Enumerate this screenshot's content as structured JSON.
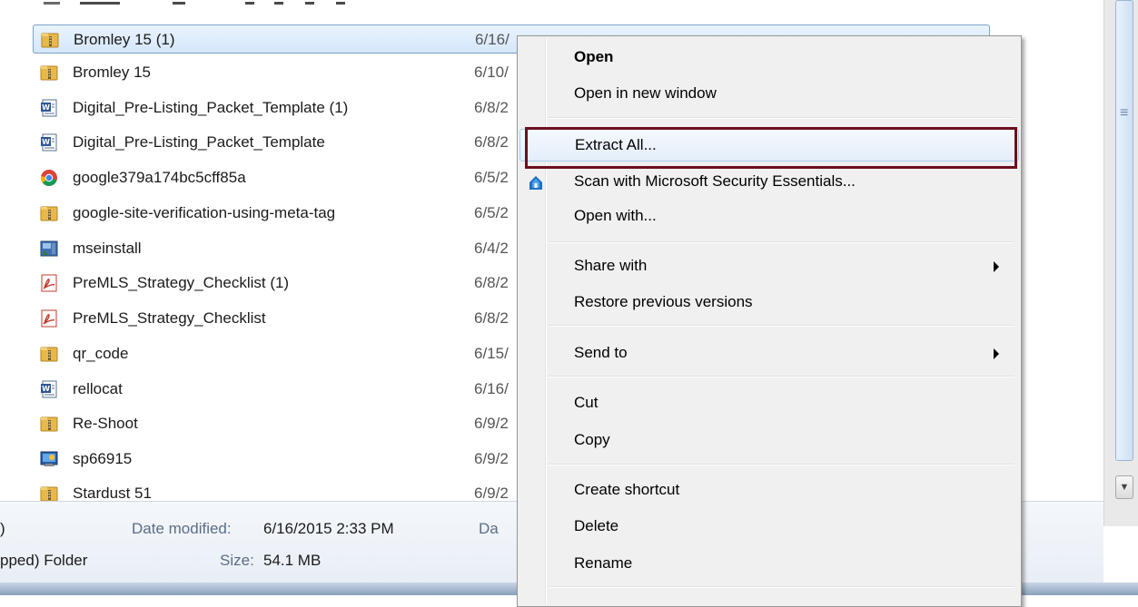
{
  "files": [
    {
      "name": "Bromley 15 (1)",
      "date": "6/16/",
      "icon": "zip-folder-icon",
      "selected": true
    },
    {
      "name": "Bromley 15",
      "date": "6/10/",
      "icon": "zip-folder-icon"
    },
    {
      "name": "Digital_Pre-Listing_Packet_Template (1)",
      "date": "6/8/2",
      "icon": "word-doc-icon"
    },
    {
      "name": "Digital_Pre-Listing_Packet_Template",
      "date": "6/8/2",
      "icon": "word-doc-icon"
    },
    {
      "name": "google379a174bc5cff85a",
      "date": "6/5/2",
      "icon": "chrome-icon"
    },
    {
      "name": "google-site-verification-using-meta-tag",
      "date": "6/5/2",
      "icon": "zip-folder-icon"
    },
    {
      "name": "mseinstall",
      "date": "6/4/2",
      "icon": "installer-icon"
    },
    {
      "name": "PreMLS_Strategy_Checklist (1)",
      "date": "6/8/2",
      "icon": "pdf-icon"
    },
    {
      "name": "PreMLS_Strategy_Checklist",
      "date": "6/8/2",
      "icon": "pdf-icon"
    },
    {
      "name": "qr_code",
      "date": "6/15/",
      "icon": "zip-folder-icon"
    },
    {
      "name": "rellocat",
      "date": "6/16/",
      "icon": "word-doc-icon"
    },
    {
      "name": "Re-Shoot",
      "date": "6/9/2",
      "icon": "zip-folder-icon"
    },
    {
      "name": "sp66915",
      "date": "6/9/2",
      "icon": "setup-icon"
    },
    {
      "name": "Stardust 51",
      "date": "6/9/2",
      "icon": "zip-folder-icon"
    }
  ],
  "details": {
    "date_modified_label": "Date modified:",
    "date_modified_value": "6/16/2015 2:33 PM",
    "size_label": "Size:",
    "size_value": "54.1 MB",
    "type_fragment": "pped) Folder",
    "left_fragment": ")",
    "date_created_fragment": "Da"
  },
  "context_menu": {
    "items": [
      {
        "label": "Open",
        "bold": true
      },
      {
        "label": "Open in new window"
      },
      {
        "label": "Extract All...",
        "highlighted": true
      },
      {
        "label": "Scan with Microsoft Security Essentials...",
        "icon": "security-essentials-icon"
      },
      {
        "label": "Open with..."
      },
      {
        "label": "Share with",
        "submenu": true
      },
      {
        "label": "Restore previous versions"
      },
      {
        "label": "Send to",
        "submenu": true
      },
      {
        "label": "Cut"
      },
      {
        "label": "Copy"
      },
      {
        "label": "Create shortcut"
      },
      {
        "label": "Delete"
      },
      {
        "label": "Rename"
      }
    ]
  },
  "colors": {
    "selection_bg": "#d5e7fb",
    "highlight_outline": "#6b0f1f",
    "menu_bg": "#f0f0f0"
  }
}
